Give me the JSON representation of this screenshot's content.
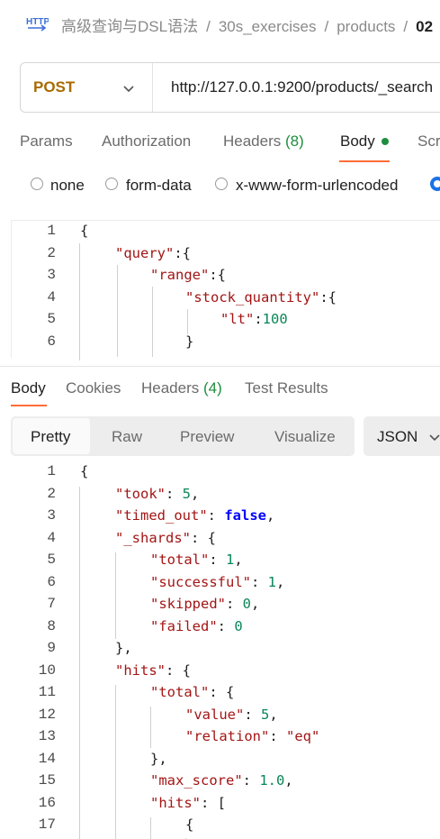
{
  "breadcrumb": {
    "icon": "http-icon",
    "items": [
      "高级查询与DSL语法",
      "30s_exercises",
      "products",
      "02"
    ],
    "separator": "/"
  },
  "request": {
    "method": "POST",
    "method_color": "#a86a00",
    "url": "http://127.0.0.1:9200/products/_search"
  },
  "request_tabs": {
    "params": "Params",
    "authorization": "Authorization",
    "headers_label": "Headers",
    "headers_count": "(8)",
    "body": "Body",
    "scripts": "Scr"
  },
  "body_modes": {
    "none": "none",
    "form_data": "form-data",
    "urlencoded": "x-www-form-urlencoded"
  },
  "request_code": {
    "line_numbers": [
      "1",
      "2",
      "3",
      "4",
      "5",
      "6"
    ],
    "l1": "{",
    "l2_key": "\"query\"",
    "l2_rest": ":{",
    "l3_key": "\"range\"",
    "l3_rest": ":{",
    "l4_key": "\"stock_quantity\"",
    "l4_rest": ":{",
    "l5_key": "\"lt\"",
    "l5_colon": ":",
    "l5_val": "100",
    "l6": "}"
  },
  "response_tabs": {
    "body": "Body",
    "cookies": "Cookies",
    "headers_label": "Headers",
    "headers_count": "(4)",
    "test_results": "Test Results"
  },
  "view_modes": {
    "pretty": "Pretty",
    "raw": "Raw",
    "preview": "Preview",
    "visualize": "Visualize",
    "format": "JSON"
  },
  "response_code": {
    "line_numbers": [
      "1",
      "2",
      "3",
      "4",
      "5",
      "6",
      "7",
      "8",
      "9",
      "10",
      "11",
      "12",
      "13",
      "14",
      "15",
      "16",
      "17"
    ],
    "l1": "{",
    "l2_key": "\"took\"",
    "l2_val": "5",
    "l3_key": "\"timed_out\"",
    "l3_val": "false",
    "l4_key": "\"_shards\"",
    "l4_rest": ": {",
    "l5_key": "\"total\"",
    "l5_val": "1",
    "l6_key": "\"successful\"",
    "l6_val": "1",
    "l7_key": "\"skipped\"",
    "l7_val": "0",
    "l8_key": "\"failed\"",
    "l8_val": "0",
    "l9": "},",
    "l10_key": "\"hits\"",
    "l10_rest": ": {",
    "l11_key": "\"total\"",
    "l11_rest": ": {",
    "l12_key": "\"value\"",
    "l12_val": "5",
    "l13_key": "\"relation\"",
    "l13_val": "\"eq\"",
    "l14": "},",
    "l15_key": "\"max_score\"",
    "l15_val": "1.0",
    "l16_key": "\"hits\"",
    "l16_rest": ": [",
    "l17": "{"
  },
  "colors": {
    "accent": "#ff6c37",
    "success": "#1e8e3e",
    "json_key": "#a31515",
    "json_number": "#098658",
    "json_bool": "#0000ff",
    "radio_selected": "#1a73e8"
  }
}
